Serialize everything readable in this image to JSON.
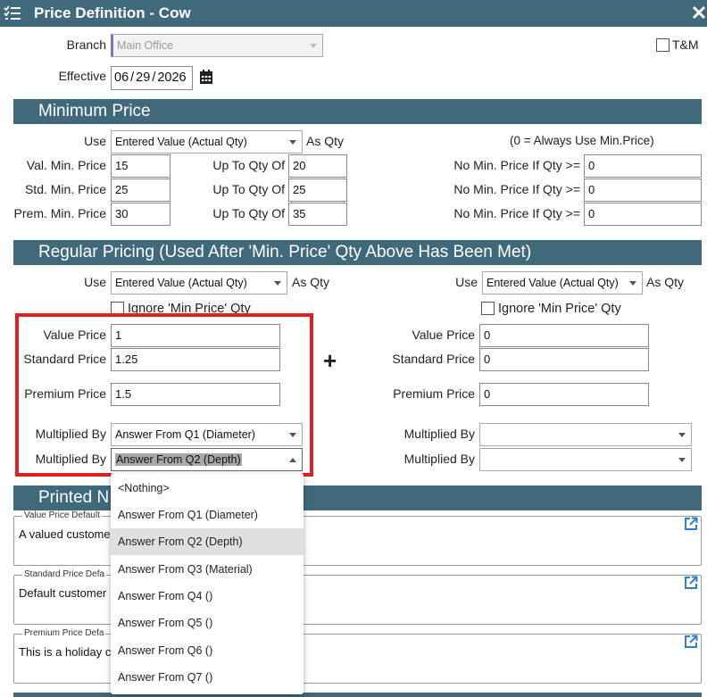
{
  "window": {
    "title": "Price Definition - Cow"
  },
  "colors": {
    "header": "#406a7c",
    "highlight_box": "#e02020",
    "selected_item": "#e0e0e0"
  },
  "header": {
    "branch_label": "Branch",
    "branch_value": "Main Office",
    "tm_label": "T&M",
    "effective_label": "Effective",
    "effective_month": "06",
    "effective_day": "29",
    "effective_year": "2026",
    "effective_sep": "/"
  },
  "minimum": {
    "title": "Minimum Price",
    "use_label": "Use",
    "use_value": "Entered Value (Actual Qty)",
    "as_qty": "As Qty",
    "note": "(0 = Always Use Min.Price)",
    "rows": [
      {
        "label": "Val. Min. Price",
        "price": "15",
        "upto_label": "Up To Qty Of",
        "upto": "20",
        "nomin_label": "No Min. Price If Qty >=",
        "nomin": "0"
      },
      {
        "label": "Std. Min. Price",
        "price": "25",
        "upto_label": "Up To Qty Of",
        "upto": "25",
        "nomin_label": "No Min. Price If Qty >=",
        "nomin": "0"
      },
      {
        "label": "Prem. Min. Price",
        "price": "30",
        "upto_label": "Up To Qty Of",
        "upto": "35",
        "nomin_label": "No Min. Price If Qty >=",
        "nomin": "0"
      }
    ]
  },
  "regular": {
    "title": "Regular Pricing (Used After 'Min. Price' Qty Above Has Been Met)",
    "plus": "+",
    "left": {
      "use_label": "Use",
      "use_value": "Entered Value (Actual Qty)",
      "as_qty": "As Qty",
      "ignore_label": "Ignore 'Min Price' Qty",
      "value_label": "Value Price",
      "value": "1",
      "standard_label": "Standard Price",
      "standard": "1.25",
      "premium_label": "Premium Price",
      "premium": "1.5",
      "mult1_label": "Multiplied By",
      "mult1": "Answer From Q1 (Diameter)",
      "mult2_label": "Multiplied By",
      "mult2": "Answer From Q2 (Depth)"
    },
    "right": {
      "use_label": "Use",
      "use_value": "Entered Value (Actual Qty)",
      "as_qty": "As Qty",
      "ignore_label": "Ignore 'Min Price' Qty",
      "value_label": "Value Price",
      "value": "0",
      "standard_label": "Standard Price",
      "standard": "0",
      "premium_label": "Premium Price",
      "premium": "0",
      "mult1_label": "Multiplied By",
      "mult1": "",
      "mult2_label": "Multiplied By",
      "mult2": ""
    }
  },
  "printed": {
    "title_visible": "Printed N",
    "notes": [
      {
        "legend": "Value Price Default",
        "text": "A valued customer"
      },
      {
        "legend": "Standard Price Defa",
        "text": "Default customer"
      },
      {
        "legend": "Premium Price Defa",
        "text": "This is a holiday cu"
      }
    ]
  },
  "dropdown": {
    "options": [
      "<Nothing>",
      "Answer From Q1 (Diameter)",
      "Answer From Q2 (Depth)",
      "Answer From Q3 (Material)",
      "Answer From Q4 ()",
      "Answer From Q5 ()",
      "Answer From Q6 ()",
      "Answer From Q7 ()"
    ],
    "selected": "Answer From Q2 (Depth)"
  },
  "icons": {
    "menu": "list-menu-icon",
    "close": "close-icon",
    "calendar": "calendar-icon",
    "external": "external-link-icon"
  }
}
